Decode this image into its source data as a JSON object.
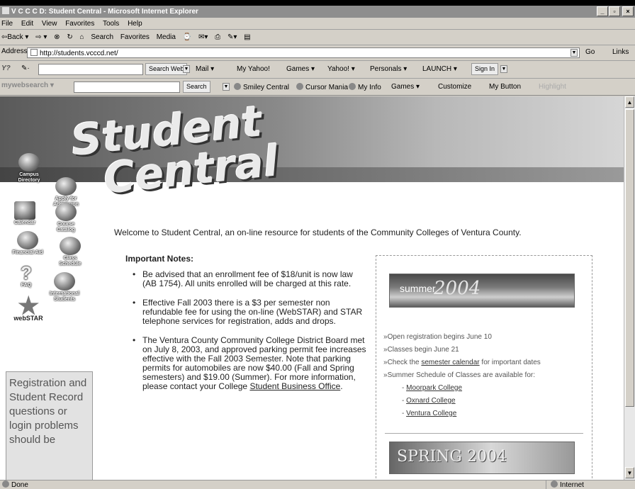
{
  "window": {
    "title": "V C C C D: Student Central - Microsoft Internet Explorer",
    "min": "_",
    "max": "▫",
    "close": "×"
  },
  "menu": [
    "File",
    "Edit",
    "View",
    "Favorites",
    "Tools",
    "Help"
  ],
  "toolbar": {
    "back": "⇦Back ▾",
    "forward": "⇨ ▾",
    "stop": "⊗",
    "refresh": "↻",
    "home": "⌂",
    "search": "Search",
    "favorites": "Favorites",
    "media": "Media",
    "history": "⌚",
    "mail": "✉▾",
    "print": "⎙",
    "edit": "✎▾",
    "discuss": "▤"
  },
  "address": {
    "label": "Address",
    "value": "http://students.vcccd.net/",
    "go": "Go",
    "links": "Links"
  },
  "yahoo": {
    "logo": "Y?",
    "pen": "✎·",
    "search_btn": "Search Web",
    "mail": "Mail ▾",
    "my_yahoo": "My Yahoo!",
    "games": "Games ▾",
    "yahoo": "Yahoo! ▾",
    "personals": "Personals ▾",
    "launch": "LAUNCH ▾",
    "signin": "Sign In"
  },
  "mws": {
    "logo": "mywebsearch ▾",
    "search": "Search",
    "smiley": "Smiley Central",
    "cursor": "Cursor Mania",
    "myinfo": "My Info",
    "games": "Games ▾",
    "customize": "Customize",
    "mybutton": "My Button",
    "highlight": "Highlight"
  },
  "logo": {
    "line1": "Student",
    "line2": "Central"
  },
  "nav": {
    "campus": "Campus Directory",
    "apply": "Apply for Admission",
    "calendar": "Calendar",
    "catalog": "Course Catalog",
    "aid": "Financial Aid",
    "schedule": "Class Schedule",
    "faq": "FAQ",
    "intl": "International Students",
    "webstar": "webSTAR"
  },
  "leftbox": "Registration and Student Record questions or login problems should be",
  "welcome": "Welcome to Student Central, an on-line resource for students of the Community Colleges of Ventura County.",
  "notes": {
    "heading": "Important Notes:",
    "n1": "Be advised that an enrollment fee of $18/unit is now law (AB 1754). All units enrolled will be charged at this rate.",
    "n2": "Effective Fall 2003 there is a $3 per semester non refundable fee for using the on-line (WebSTAR) and STAR telephone services for registration, adds and drops.",
    "n3": "The Ventura County Community College District Board met on July 8, 2003, and approved parking permit fee increases effective with the Fall 2003 Semester. Note that parking permits for automobiles are now $40.00 (Fall and Spring semesters) and $19.00 (Summer). For more information, please contact your College",
    "n3_link": "Student Business Office",
    "n3_end": "."
  },
  "summer": {
    "word": "summer",
    "year": "2004",
    "i1": "Open registration begins June 10",
    "i2": "Classes begin June 21",
    "i3_pre": "Check the",
    "i3_link": "semester calendar",
    "i3_post": "for important dates",
    "i4": "Summer Schedule of Classes are available for:",
    "c1": "Moorpark College",
    "c2": "Oxnard College",
    "c3": "Ventura College"
  },
  "spring": {
    "text": "SPRING 2004"
  },
  "status": {
    "left": "Done",
    "zone": "Internet"
  }
}
